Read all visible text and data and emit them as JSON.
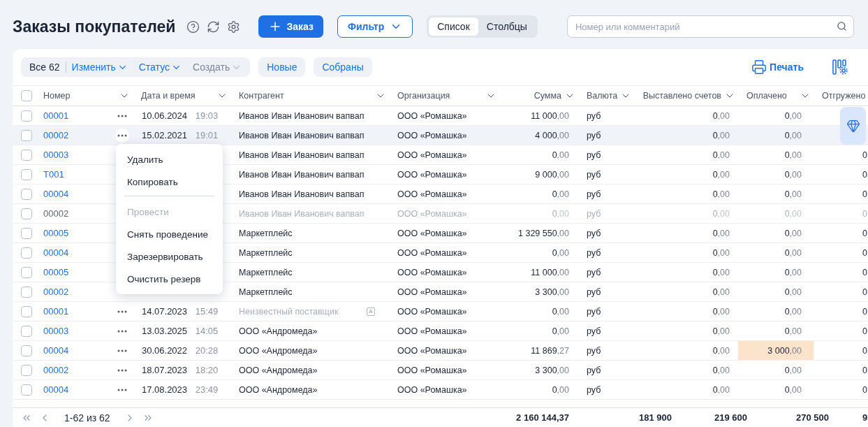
{
  "page": {
    "title": "Заказы покупателей"
  },
  "header_actions": {
    "add_button": "Заказ",
    "filter_button": "Фильтр"
  },
  "view_tabs": [
    {
      "label": "Список",
      "selected": true
    },
    {
      "label": "Столбцы",
      "selected": false
    }
  ],
  "search": {
    "placeholder": "Номер или комментарий"
  },
  "toolbar": {
    "select_all_label": "Все 62",
    "actions": [
      {
        "label": "Изменить",
        "disabled": false
      },
      {
        "label": "Статус",
        "disabled": false
      },
      {
        "label": "Создать",
        "disabled": true
      }
    ],
    "quick_filters": [
      {
        "label": "Новые"
      },
      {
        "label": "Собраны"
      }
    ],
    "print_button": "Печать"
  },
  "table": {
    "select_all_checked": false,
    "columns": [
      {
        "label": "Номер",
        "numeric": false
      },
      {
        "label": "Дата и время",
        "numeric": false
      },
      {
        "label": "Контрагент",
        "numeric": false
      },
      {
        "label": "Организация",
        "numeric": false
      },
      {
        "label": "Сумма",
        "numeric": true
      },
      {
        "label": "Валюта",
        "numeric": false
      },
      {
        "label": "Выставлено счетов",
        "numeric": true
      },
      {
        "label": "Оплачено",
        "numeric": false
      },
      {
        "label": "Отгружено",
        "numeric": false
      }
    ],
    "rows": [
      {
        "checked": false,
        "number": "00001",
        "date": "10.06.2024",
        "time": "19:03",
        "contractor": "Иванов Иван Иванович вапвап",
        "organization": "ООО «Ромашка»",
        "sum": "11 000,00",
        "currency": "руб",
        "invoiced": "0,00",
        "paid": "0,00",
        "hovered": false,
        "dimmed": false
      },
      {
        "checked": false,
        "number": "00002",
        "date": "15.02.2021",
        "time": "19:01",
        "contractor": "Иванов Иван Иванович вапвап",
        "organization": "ООО «Ромашка»",
        "sum": "4 000,00",
        "currency": "руб",
        "invoiced": "0,00",
        "paid": "0,00",
        "hovered": true,
        "dimmed": false
      },
      {
        "checked": false,
        "number": "00003",
        "contractor": "Иванов Иван Иванович вапвап",
        "organization": "ООО «Ромашка»",
        "sum": "0,00",
        "currency": "руб",
        "invoiced": "0,00",
        "paid": "0,00",
        "shipped": "0",
        "hovered": false,
        "dimmed": false
      },
      {
        "checked": false,
        "number": "T001",
        "contractor": "Иванов Иван Иванович вапвап",
        "organization": "ООО «Ромашка»",
        "sum": "9 000,00",
        "currency": "руб",
        "invoiced": "0,00",
        "paid": "0,00",
        "shipped": "0",
        "hovered": false,
        "dimmed": false
      },
      {
        "checked": false,
        "number": "00004",
        "contractor": "Иванов Иван Иванович вапвап",
        "organization": "ООО «Ромашка»",
        "sum": "0,00",
        "currency": "руб",
        "invoiced": "0,00",
        "paid": "0,00",
        "shipped": "0",
        "hovered": false,
        "dimmed": false
      },
      {
        "checked": false,
        "number": "00002",
        "contractor": "Иванов Иван Иванович вапвап",
        "organization": "ООО «Ромашка»",
        "sum": "0,00",
        "currency": "руб",
        "invoiced": "0,00",
        "paid": "0,00",
        "shipped": "0",
        "hovered": false,
        "dimmed": true
      },
      {
        "checked": false,
        "number": "00005",
        "contractor": "Маркетплейс",
        "organization": "ООО «Ромашка»",
        "sum": "1 329 550,00",
        "currency": "руб",
        "invoiced": "0,00",
        "paid": "0,00",
        "shipped": "0",
        "hovered": false,
        "dimmed": false
      },
      {
        "checked": false,
        "number": "00004",
        "contractor": "Маркетплейс",
        "organization": "ООО «Ромашка»",
        "sum": "0,00",
        "currency": "руб",
        "invoiced": "0,00",
        "paid": "0,00",
        "shipped": "0",
        "hovered": false,
        "dimmed": false
      },
      {
        "checked": false,
        "number": "00005",
        "contractor": "Маркетплейс",
        "organization": "ООО «Ромашка»",
        "sum": "11 000,00",
        "currency": "руб",
        "invoiced": "0,00",
        "paid": "0,00",
        "shipped": "0",
        "hovered": false,
        "dimmed": false
      },
      {
        "checked": false,
        "number": "00002",
        "contractor": "Маркетплейс",
        "organization": "ООО «Ромашка»",
        "sum": "3 300,00",
        "currency": "руб",
        "invoiced": "0,00",
        "paid": "0,00",
        "shipped": "0",
        "hovered": false,
        "dimmed": false
      },
      {
        "checked": false,
        "number": "00001",
        "date": "14.07.2023",
        "time": "15:49",
        "contractor": "Неизвестный поставщик",
        "contractor_muted": true,
        "contractor_tag": "A",
        "organization": "ООО «Ромашка»",
        "sum": "0,00",
        "currency": "руб",
        "invoiced": "0,00",
        "paid": "0,00",
        "shipped": "0",
        "hovered": false,
        "dimmed": false
      },
      {
        "checked": false,
        "number": "00003",
        "date": "13.03.2025",
        "time": "14:05",
        "contractor": "ООО «Андромеда»",
        "organization": "ООО «Ромашка»",
        "sum": "0,00",
        "currency": "руб",
        "invoiced": "0,00",
        "paid": "0,00",
        "shipped": "0",
        "hovered": false,
        "dimmed": false
      },
      {
        "checked": false,
        "number": "00004",
        "date": "30.06.2022",
        "time": "20:28",
        "contractor": "ООО «Андромеда»",
        "organization": "ООО «Ромашка»",
        "sum": "11 869,27",
        "currency": "руб",
        "invoiced": "0,00",
        "paid": "3 000,00",
        "paid_highlight": true,
        "shipped": "0",
        "hovered": false,
        "dimmed": false
      },
      {
        "checked": false,
        "number": "00002",
        "date": "18.07.2023",
        "time": "18:20",
        "contractor": "ООО «Андромеда»",
        "organization": "ООО «Ромашка»",
        "sum": "3 300,00",
        "currency": "руб",
        "invoiced": "0,00",
        "paid": "0,00",
        "shipped": "0",
        "hovered": false,
        "dimmed": false
      },
      {
        "checked": false,
        "number": "00004",
        "date": "17.08.2023",
        "time": "23:49",
        "contractor": "ООО «Андромеда»",
        "organization": "ООО «Ромашка»",
        "sum": "0,00",
        "currency": "руб",
        "invoiced": "0,00",
        "paid": "0,00",
        "shipped": "0",
        "hovered": false,
        "dimmed": false
      }
    ]
  },
  "context_menu": {
    "items": [
      {
        "kind": "item",
        "label": "Удалить",
        "disabled": false
      },
      {
        "kind": "item",
        "label": "Копировать",
        "disabled": false
      },
      {
        "kind": "divider"
      },
      {
        "kind": "item",
        "label": "Провести",
        "disabled": true
      },
      {
        "kind": "item",
        "label": "Снять проведение",
        "disabled": false
      },
      {
        "kind": "item",
        "label": "Зарезервировать",
        "disabled": false
      },
      {
        "kind": "item",
        "label": "Очистить резерв",
        "disabled": false
      }
    ]
  },
  "footer": {
    "pagination": "1-62 из 62",
    "totals": [
      "2 160 144,37",
      "181 900",
      "219 600",
      "270 500",
      "9"
    ]
  }
}
